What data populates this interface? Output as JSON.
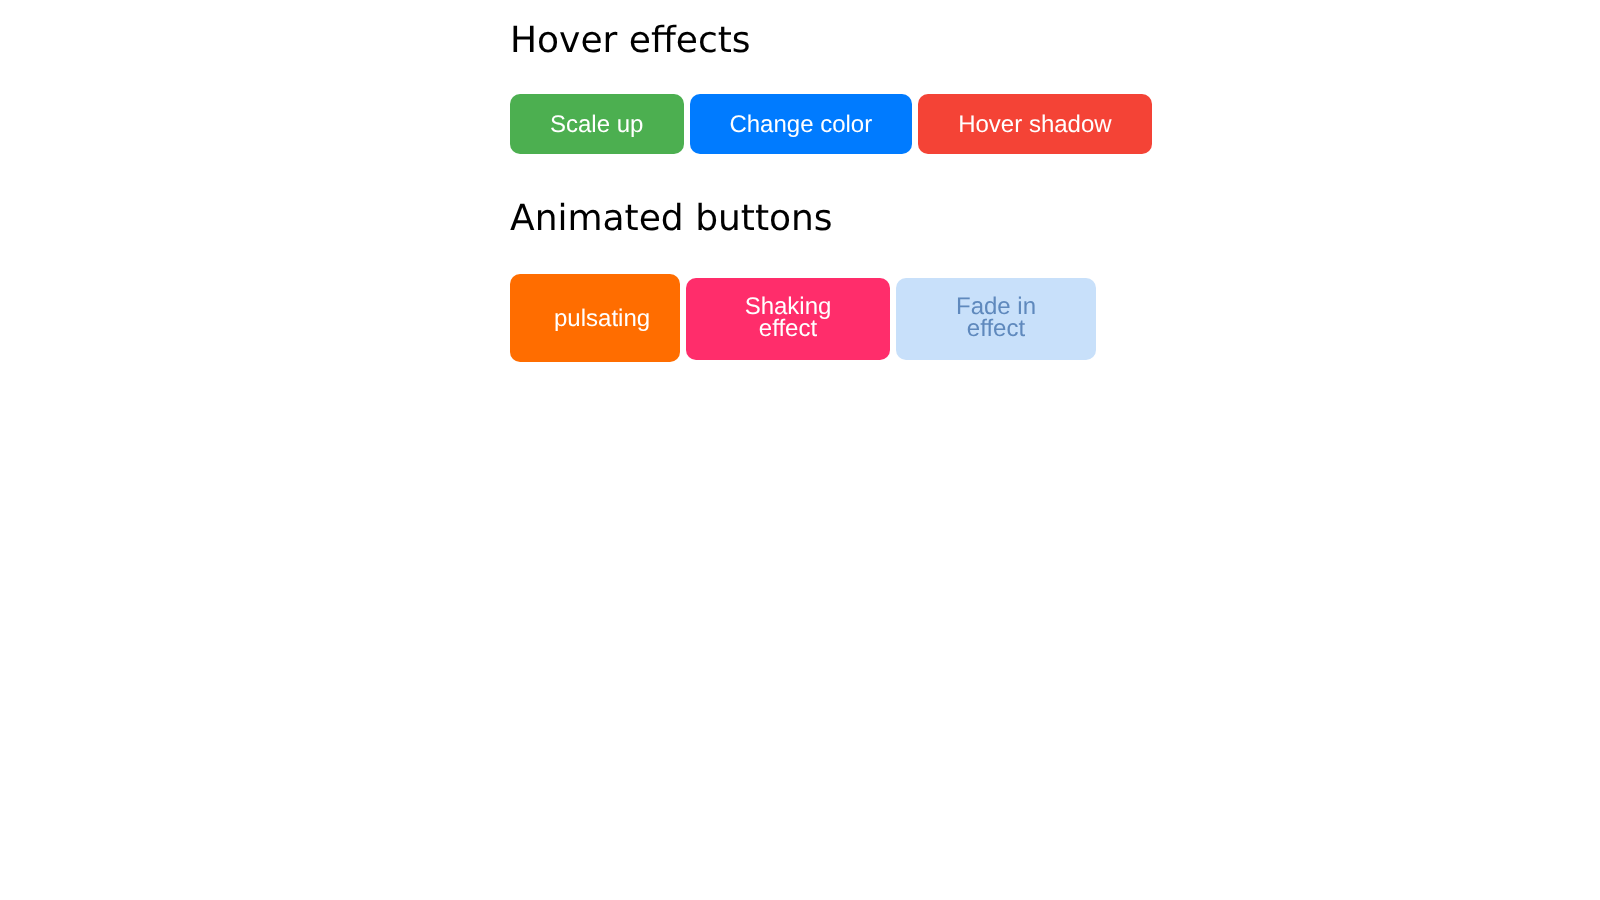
{
  "sections": [
    {
      "title": "Hover effects",
      "buttons": [
        {
          "label": "Scale up",
          "color": "#4caf50"
        },
        {
          "label": "Change color",
          "color": "#007bff"
        },
        {
          "label": "Hover shadow",
          "color": "#f44336"
        }
      ]
    },
    {
      "title": "Animated buttons",
      "buttons": [
        {
          "label": "pulsating",
          "color": "#ff6d00",
          "kind": "pulse"
        },
        {
          "label": "Shaking effect",
          "color": "#ff2d6b",
          "kind": "shake"
        },
        {
          "label": "Fade in effect",
          "color": "#c8e0fa",
          "kind": "fade"
        }
      ]
    }
  ]
}
